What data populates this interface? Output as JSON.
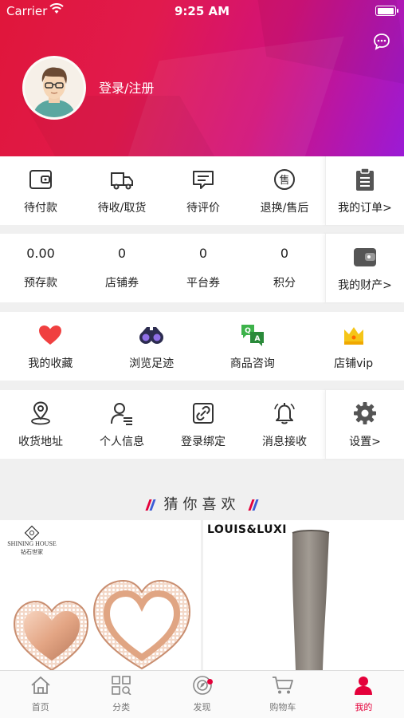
{
  "status": {
    "carrier": "Carrier",
    "time": "9:25 AM",
    "battery_level": 1.0
  },
  "header": {
    "login_label": "登录/注册"
  },
  "orders": {
    "items": [
      {
        "label": "待付款",
        "icon": "wallet-icon"
      },
      {
        "label": "待收/取货",
        "icon": "truck-icon"
      },
      {
        "label": "待评价",
        "icon": "comment-icon"
      },
      {
        "label": "退换/售后",
        "icon": "after-sale-icon"
      }
    ],
    "link": {
      "label": "我的订单>",
      "icon": "clipboard-icon"
    }
  },
  "assets": {
    "items": [
      {
        "value": "0.00",
        "label": "预存款"
      },
      {
        "value": "0",
        "label": "店铺券"
      },
      {
        "value": "0",
        "label": "平台券"
      },
      {
        "value": "0",
        "label": "积分"
      }
    ],
    "link": {
      "label": "我的财产>",
      "icon": "purse-icon"
    }
  },
  "features": {
    "items": [
      {
        "label": "我的收藏",
        "icon": "heart-icon"
      },
      {
        "label": "浏览足迹",
        "icon": "binoculars-icon"
      },
      {
        "label": "商品咨询",
        "icon": "qa-icon"
      },
      {
        "label": "店铺vip",
        "icon": "crown-icon"
      }
    ]
  },
  "settings": {
    "items": [
      {
        "label": "收货地址",
        "icon": "location-icon"
      },
      {
        "label": "个人信息",
        "icon": "person-icon"
      },
      {
        "label": "登录绑定",
        "icon": "link-icon"
      },
      {
        "label": "消息接收",
        "icon": "bell-icon"
      }
    ],
    "link": {
      "label": "设置>",
      "icon": "gear-icon"
    }
  },
  "recommend": {
    "title": "猜你喜欢",
    "products": [
      {
        "brand": "SHINING HOUSE",
        "brand_sub": "钻石世家"
      },
      {
        "brand": "LOUIS&LUXI"
      }
    ]
  },
  "tabbar": {
    "tabs": [
      {
        "label": "首页",
        "icon": "home-icon",
        "active": false
      },
      {
        "label": "分类",
        "icon": "category-icon",
        "active": false
      },
      {
        "label": "发现",
        "icon": "discover-icon",
        "active": false,
        "badge": true
      },
      {
        "label": "购物车",
        "icon": "cart-icon",
        "active": false
      },
      {
        "label": "我的",
        "icon": "profile-icon",
        "active": true
      }
    ]
  },
  "colors": {
    "accent": "#e4003a",
    "header_start": "#e0163a",
    "header_end": "#9b1ad6"
  }
}
